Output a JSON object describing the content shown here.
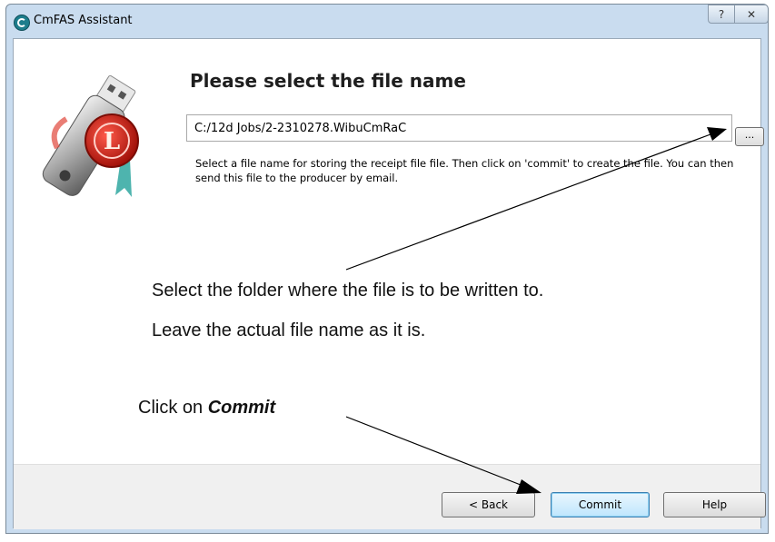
{
  "window": {
    "title": "CmFAS Assistant",
    "help_glyph": "?",
    "close_glyph": "✕"
  },
  "page": {
    "heading": "Please select the file name",
    "filename_value": "C:/12d Jobs/2-2310278.WibuCmRaC",
    "browse_label": "...",
    "description": "Select a file name for storing the receipt file file. Then click on 'commit' to create the file. You can then send this file to the producer by email."
  },
  "annotations": {
    "select_folder": "Select the folder where the file is to be written to.",
    "leave_name": "Leave the actual file name as it is.",
    "click_on_prefix": "Click on ",
    "click_on_target": "Commit"
  },
  "buttons": {
    "back": "< Back",
    "commit": "Commit",
    "help": "Help"
  },
  "icons": {
    "app": "cmfas-app-icon",
    "logo": "usb-dongle-wax-seal-logo"
  },
  "colors": {
    "window_frame": "#c9dcef",
    "footer": "#f0f0f0",
    "commit_focus": "#3c7fb1"
  }
}
